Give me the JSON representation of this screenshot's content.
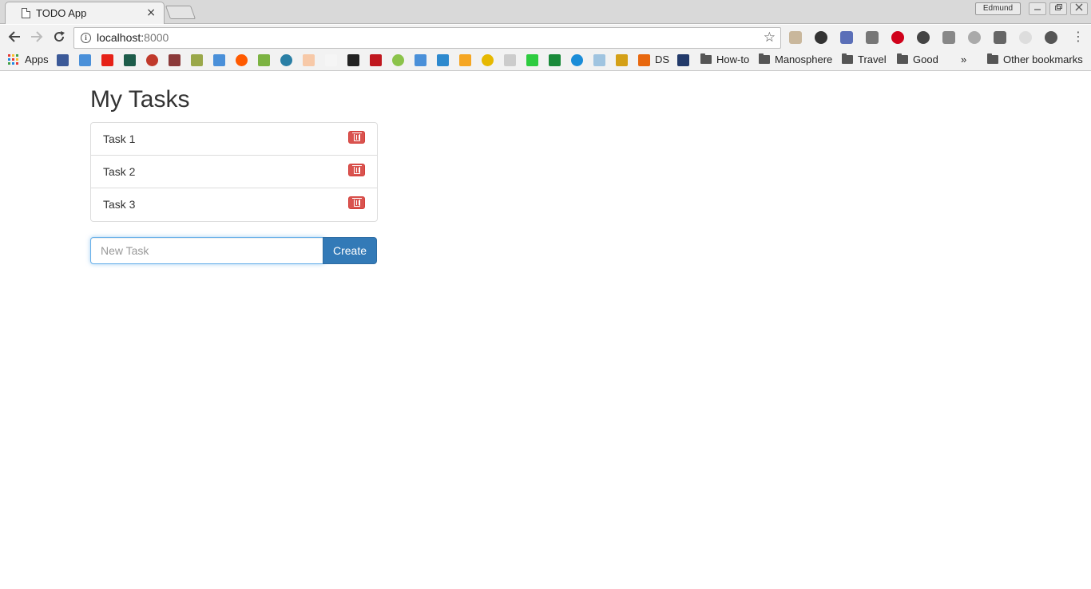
{
  "browser": {
    "tab_title": "TODO App",
    "tab_close": "×",
    "profile_name": "Edmund",
    "url_host": "localhost:",
    "url_port": "8000",
    "menu_glyph": "⋮"
  },
  "bookmarks": {
    "apps_label": "Apps",
    "ds_label": "DS",
    "folders": [
      "How-to",
      "Manosphere",
      "Travel",
      "Good"
    ],
    "overflow": "»",
    "other_label": "Other bookmarks"
  },
  "page": {
    "title": "My Tasks",
    "tasks": [
      {
        "label": "Task 1"
      },
      {
        "label": "Task 2"
      },
      {
        "label": "Task 3"
      }
    ],
    "new_task_placeholder": "New Task",
    "new_task_value": "",
    "create_label": "Create"
  },
  "colors": {
    "primary": "#337ab7",
    "danger": "#d9534f",
    "text": "#333333"
  }
}
